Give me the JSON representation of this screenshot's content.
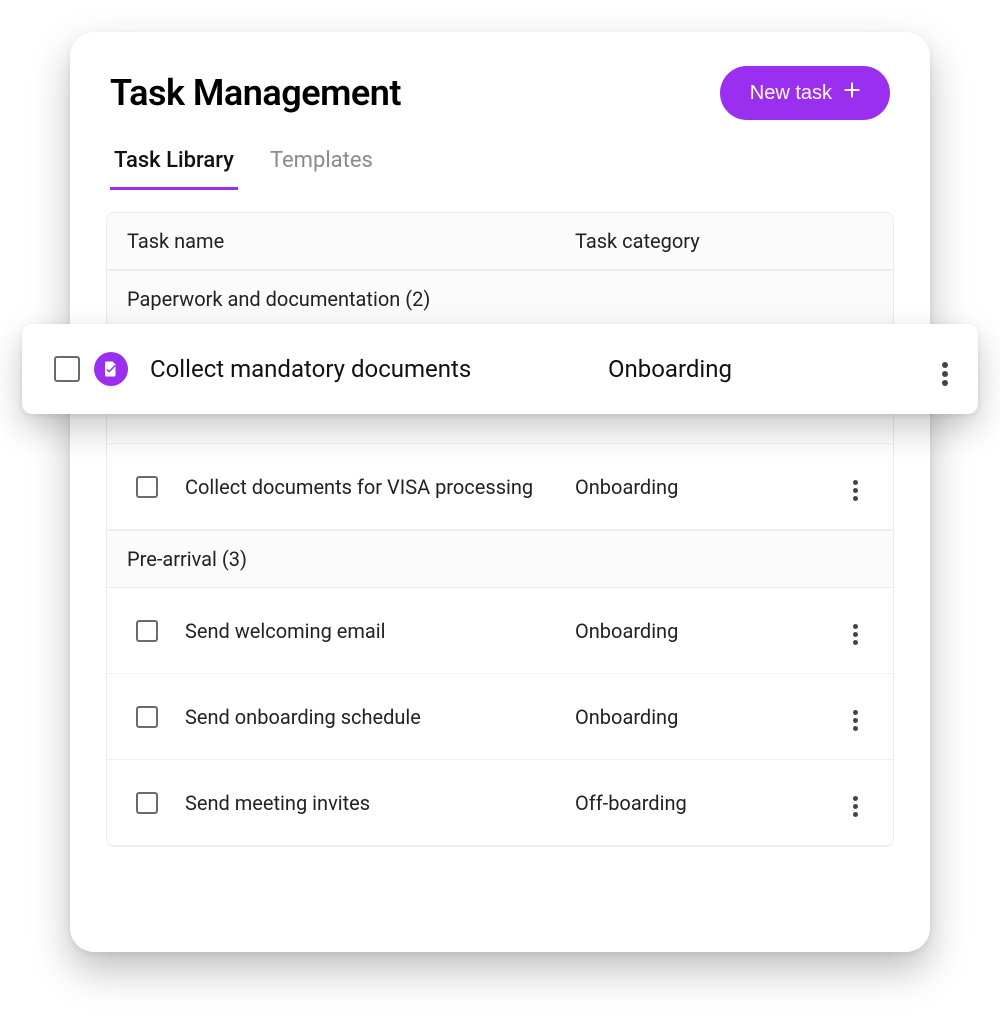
{
  "header": {
    "title": "Task Management",
    "new_task_label": "New task"
  },
  "tabs": [
    {
      "label": "Task Library",
      "active": true
    },
    {
      "label": "Templates",
      "active": false
    }
  ],
  "columns": {
    "name": "Task name",
    "category": "Task category"
  },
  "groups": [
    {
      "label": "Paperwork and documentation (2)",
      "tasks": [
        {
          "name": "Collect mandatory documents",
          "category": "Onboarding",
          "highlighted": true,
          "has_doc_icon": true
        },
        {
          "name": "Collect documents for VISA processing",
          "category": "Onboarding"
        }
      ]
    },
    {
      "label": "Pre-arrival (3)",
      "tasks": [
        {
          "name": "Send welcoming email",
          "category": "Onboarding"
        },
        {
          "name": "Send onboarding schedule",
          "category": "Onboarding"
        },
        {
          "name": "Send meeting invites",
          "category": "Off-boarding"
        }
      ]
    }
  ],
  "colors": {
    "accent": "#9a2ff0"
  }
}
